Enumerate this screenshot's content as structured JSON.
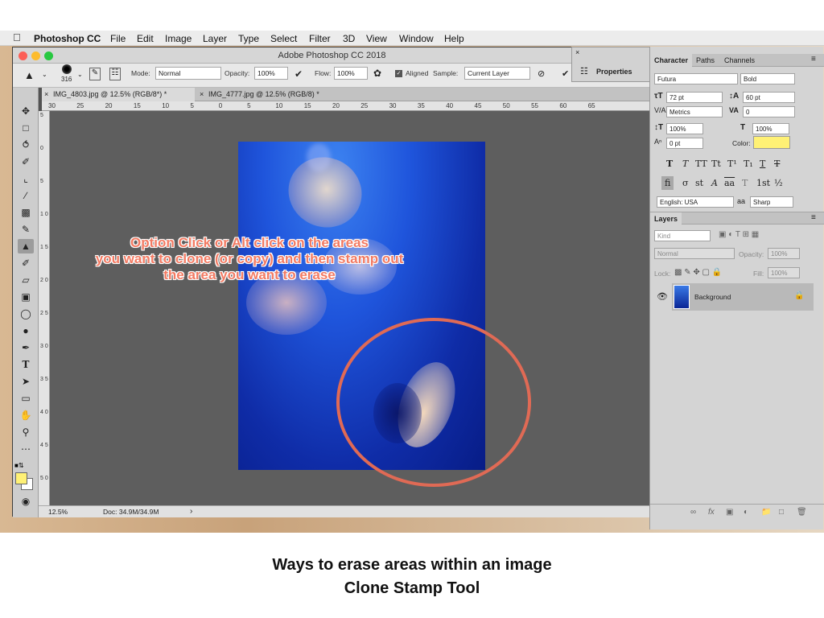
{
  "menubar": {
    "apple": "",
    "app": "Photoshop CC",
    "items": [
      "File",
      "Edit",
      "Image",
      "Layer",
      "Type",
      "Select",
      "Filter",
      "3D",
      "View",
      "Window",
      "Help"
    ]
  },
  "window": {
    "title": "Adobe Photoshop CC 2018"
  },
  "options": {
    "brush_size": "316",
    "mode_label": "Mode:",
    "mode_value": "Normal",
    "opacity_label": "Opacity:",
    "opacity_value": "100%",
    "flow_label": "Flow:",
    "flow_value": "100%",
    "aligned_label": "Aligned",
    "sample_label": "Sample:",
    "sample_value": "Current Layer"
  },
  "tabs": [
    {
      "label": "IMG_4803.jpg @ 12.5% (RGB/8*) *"
    },
    {
      "label": "IMG_4777.jpg @ 12.5% (RGB/8) *"
    }
  ],
  "ruler_top": [
    "30",
    "25",
    "20",
    "15",
    "10",
    "5",
    "0",
    "5",
    "10",
    "15",
    "20",
    "25",
    "30",
    "35",
    "40",
    "45",
    "50",
    "55",
    "60",
    "65"
  ],
  "ruler_left": [
    "5",
    "0",
    "5",
    "1 0",
    "1 5",
    "2 0",
    "2 5",
    "3 0",
    "3 5",
    "4 0",
    "4 5",
    "5 0"
  ],
  "status": {
    "zoom": "12.5%",
    "doc": "Doc: 34.9M/34.9M",
    "arrow": "›"
  },
  "properties": {
    "label": "Properties"
  },
  "annotation": {
    "line1": "Option Click or Alt click on the areas",
    "line2": "you want to clone (or copy) and then stamp out",
    "line3": "the area you want to erase"
  },
  "character": {
    "tabs": [
      "Character",
      "Paths",
      "Channels"
    ],
    "font_family": "Futura",
    "font_style": "Bold",
    "size": "72 pt",
    "leading": "60 pt",
    "kerning": "Metrics",
    "tracking": "0",
    "vscale": "100%",
    "hscale": "100%",
    "baseline": "0 pt",
    "color_label": "Color:",
    "language": "English: USA",
    "aa_label": "aa",
    "antialias": "Sharp"
  },
  "layers": {
    "tab": "Layers",
    "kind": "Kind",
    "blend": "Normal",
    "opacity_label": "Opacity:",
    "opacity_value": "100%",
    "lock_label": "Lock:",
    "fill_label": "Fill:",
    "fill_value": "100%",
    "layer_name": "Background"
  },
  "caption": {
    "line1": "Ways to erase areas within an image",
    "line2": "Clone Stamp Tool"
  },
  "colors": {
    "foreground": "#fff175",
    "accent_annotation": "#f37b63",
    "circle": "#e06a55"
  }
}
